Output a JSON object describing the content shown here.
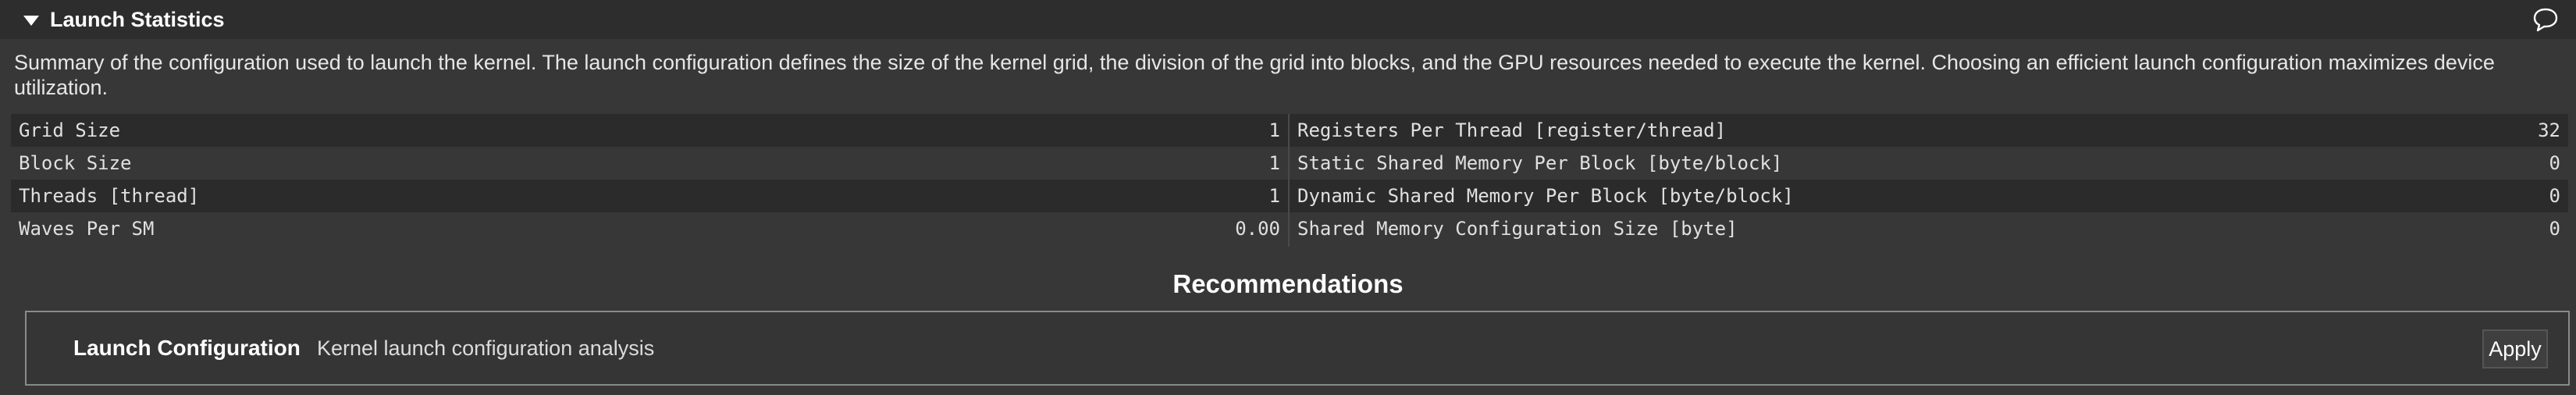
{
  "section": {
    "title": "Launch Statistics",
    "summary": "Summary of the configuration used to launch the kernel. The launch configuration defines the size of the kernel grid, the division of the grid into blocks, and the GPU resources needed to execute the kernel. Choosing an efficient launch configuration maximizes device utilization."
  },
  "metrics": {
    "left": [
      {
        "label": "Grid Size",
        "value": "1"
      },
      {
        "label": "Block Size",
        "value": "1"
      },
      {
        "label": "Threads [thread]",
        "value": "1"
      },
      {
        "label": "Waves Per SM",
        "value": "0.00"
      }
    ],
    "right": [
      {
        "label": "Registers Per Thread [register/thread]",
        "value": "32"
      },
      {
        "label": "Static Shared Memory Per Block [byte/block]",
        "value": "0"
      },
      {
        "label": "Dynamic Shared Memory Per Block [byte/block]",
        "value": "0"
      },
      {
        "label": "Shared Memory Configuration Size [byte]",
        "value": "0"
      }
    ]
  },
  "recommendations": {
    "title": "Recommendations",
    "items": [
      {
        "name": "Launch Configuration",
        "description": "Kernel launch configuration analysis",
        "apply_label": "Apply"
      }
    ]
  },
  "icons": {
    "collapse": "triangle-down-icon",
    "comment": "speech-bubble-icon"
  },
  "colors": {
    "header_bg": "#2d2d2d",
    "body_bg": "#373737",
    "row_dark": "#2b2b2b",
    "text": "#dcdcdc"
  }
}
